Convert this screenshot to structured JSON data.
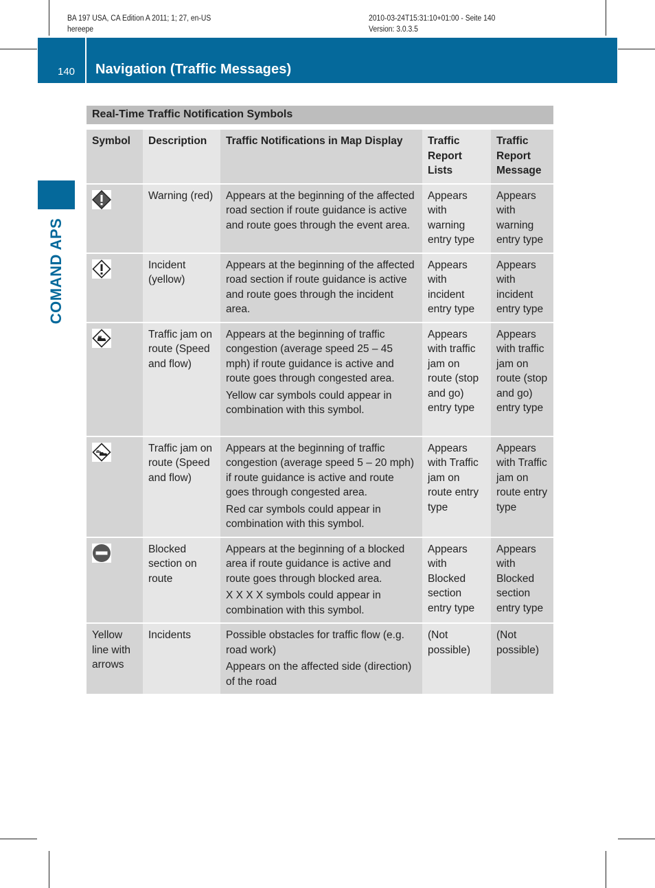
{
  "print_meta": {
    "left_line1": "BA 197 USA, CA Edition A 2011; 1; 27, en-US",
    "left_line2": "hereepe",
    "right_line1": "2010-03-24T15:31:10+01:00 - Seite 140",
    "right_line2": "Version: 3.0.3.5"
  },
  "header": {
    "page_number": "140",
    "title": "Navigation (Traffic Messages)",
    "accent_color": "#05699b"
  },
  "side_tab": {
    "label": "COMAND APS"
  },
  "table": {
    "title": "Real-Time Traffic Notification Symbols",
    "columns": [
      "Symbol",
      "Description",
      "Traffic Notifications in Map Display",
      "Traffic Report Lists",
      "Traffic Report Message"
    ],
    "rows": [
      {
        "symbol_icon": "warning-filled-diamond-icon",
        "symbol_text": "",
        "description": "Warning (red)",
        "map_display": [
          "Appears at the beginning of the affected road section if route guidance is active and route goes through the event area."
        ],
        "report_lists": "Appears with warning entry type",
        "report_message": "Appears with warning entry type"
      },
      {
        "symbol_icon": "incident-outline-diamond-icon",
        "symbol_text": "",
        "description": "Incident (yellow)",
        "map_display": [
          "Appears at the beginning of the affected road section if route guidance is active and route goes through the incident area."
        ],
        "report_lists": "Appears with incident entry type",
        "report_message": "Appears with incident entry type"
      },
      {
        "symbol_icon": "traffic-jam-speed-flow-icon",
        "symbol_text": "",
        "description": "Traffic jam on route (Speed and flow)",
        "map_display": [
          "Appears at the beginning of traffic congestion (average speed 25 – 45 mph) if route guidance is active and route goes through congested area.",
          "Yellow car symbols could appear in combination with this symbol."
        ],
        "report_lists": "Appears with traffic jam on route (stop and go) entry type",
        "report_message": "Appears with traffic jam on route (stop and go) entry type"
      },
      {
        "symbol_icon": "traffic-jam-stop-go-icon",
        "symbol_text": "",
        "description": "Traffic jam on route (Speed and flow)",
        "map_display": [
          "Appears at the beginning of traffic congestion (average speed 5 – 20 mph) if route guidance is active and route goes through congested area.",
          "Red car symbols could appear in combination with this symbol."
        ],
        "report_lists": "Appears with Traffic jam on route entry type",
        "report_message": "Appears with Traffic jam on route entry type"
      },
      {
        "symbol_icon": "blocked-section-icon",
        "symbol_text": "",
        "description": "Blocked section on route",
        "map_display": [
          "Appears at the beginning of a blocked area if route guidance is active and route goes through blocked area.",
          "X X X X symbols could appear in combination with this symbol."
        ],
        "report_lists": "Appears with Blocked section entry type",
        "report_message": "Appears with Blocked section entry type"
      },
      {
        "symbol_icon": "",
        "symbol_text": "Yellow line with arrows",
        "description": "Incidents",
        "map_display": [
          "Possible obstacles for traffic flow (e.g. road work)",
          "Appears on the affected side (direction) of the road"
        ],
        "report_lists": "(Not possible)",
        "report_message": "(Not possible)"
      }
    ]
  }
}
